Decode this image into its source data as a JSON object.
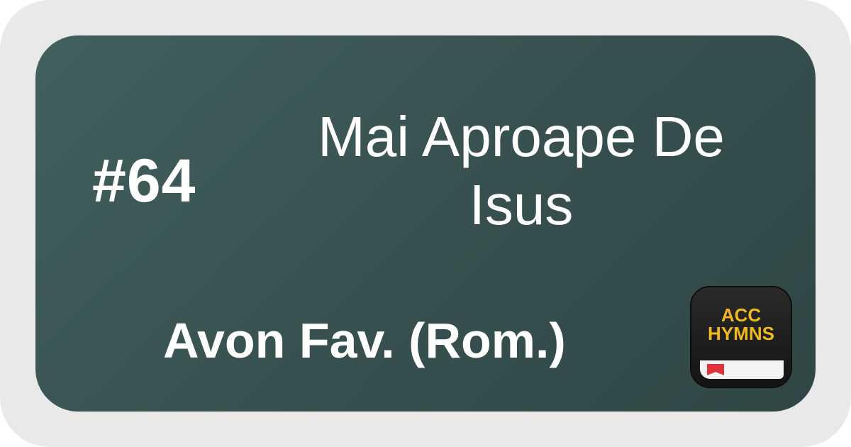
{
  "hymn": {
    "number": "#64",
    "title": "Mai Aproape De Isus",
    "collection": "Avon Fav. (Rom.)"
  },
  "logo": {
    "line1": "ACC",
    "line2": "HYMNS"
  },
  "colors": {
    "card_background": "#385150",
    "outer_frame": "#e9e9e9",
    "text": "#ffffff",
    "logo_text": "#f0b81a",
    "logo_bookmark": "#e0343c"
  }
}
